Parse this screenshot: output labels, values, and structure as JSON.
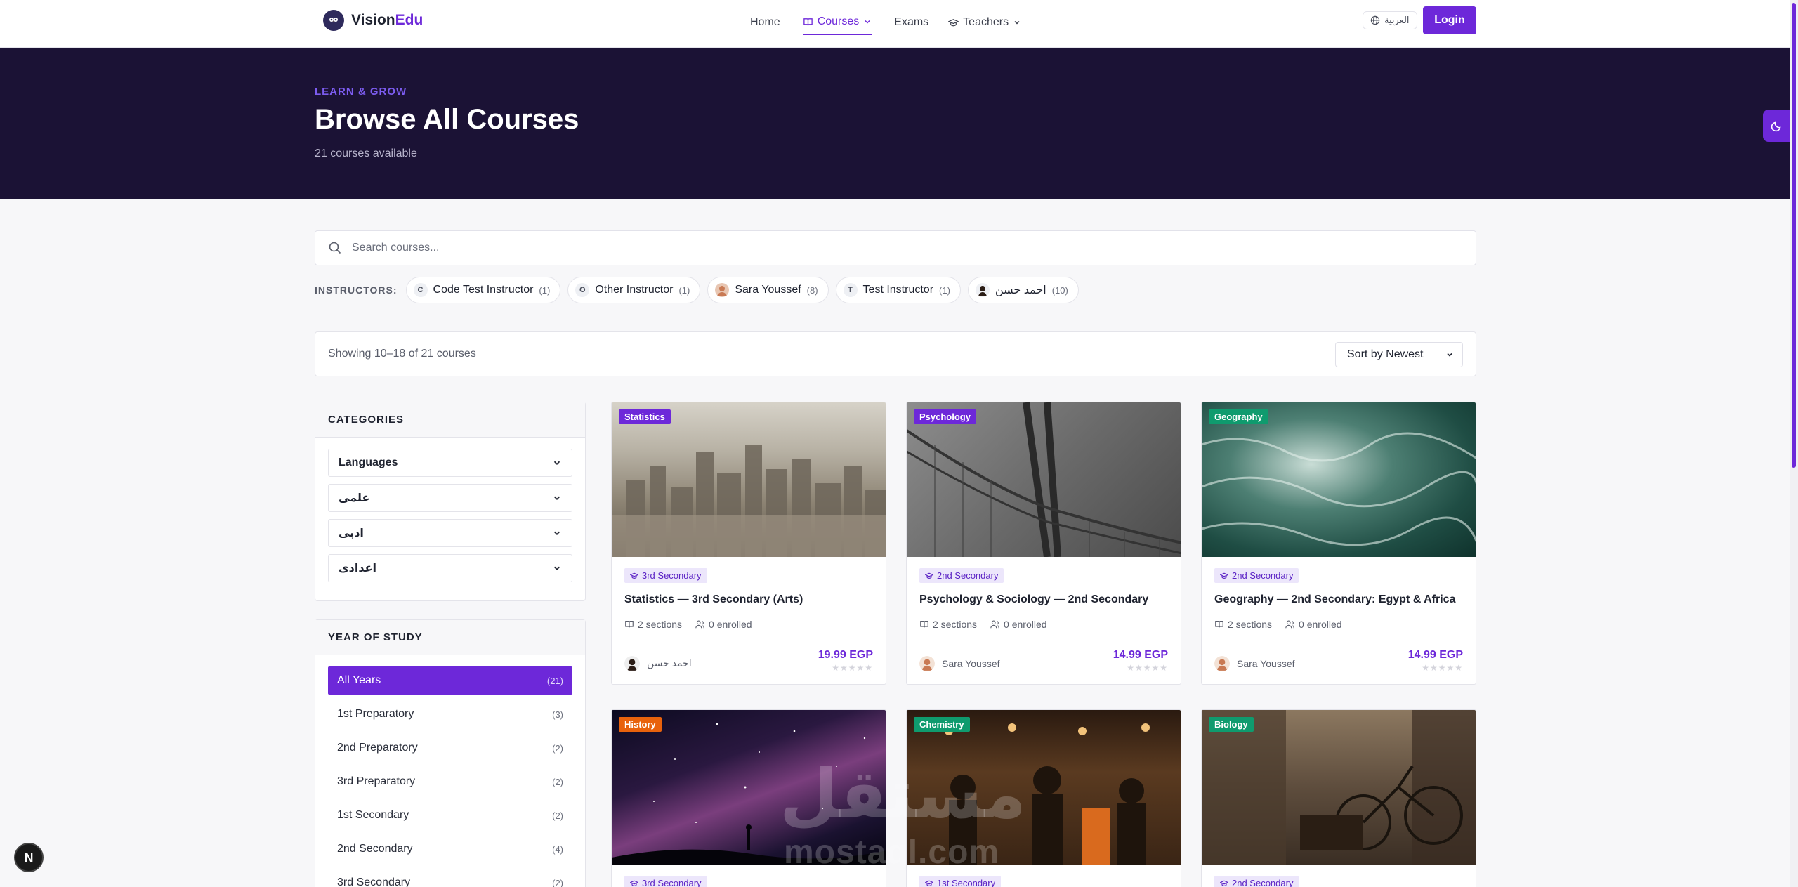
{
  "brand": {
    "name_main": "Vision",
    "name_accent": "Edu"
  },
  "nav": {
    "home": "Home",
    "courses": "Courses",
    "exams": "Exams",
    "teachers": "Teachers"
  },
  "header_actions": {
    "language": "العربية",
    "login": "Login"
  },
  "hero": {
    "eyebrow": "LEARN & GROW",
    "title": "Browse All Courses",
    "subtitle": "21 courses available"
  },
  "search": {
    "placeholder": "Search courses..."
  },
  "instructors": {
    "label": "INSTRUCTORS:",
    "items": [
      {
        "initial": "C",
        "name": "Code Test Instructor",
        "count": "(1)"
      },
      {
        "initial": "O",
        "name": "Other Instructor",
        "count": "(1)"
      },
      {
        "initial": "",
        "name": "Sara Youssef",
        "count": "(8)"
      },
      {
        "initial": "T",
        "name": "Test Instructor",
        "count": "(1)"
      },
      {
        "initial": "",
        "name": "احمد حسن",
        "count": "(10)"
      }
    ]
  },
  "toolbar": {
    "showing": "Showing 10–18 of 21 courses",
    "sort": "Sort by Newest"
  },
  "categories": {
    "title": "CATEGORIES",
    "items": [
      "Languages",
      "علمى",
      "ادبى",
      "اعدادى"
    ]
  },
  "years": {
    "title": "YEAR OF STUDY",
    "items": [
      {
        "label": "All Years",
        "count": "(21)"
      },
      {
        "label": "1st Preparatory",
        "count": "(3)"
      },
      {
        "label": "2nd Preparatory",
        "count": "(2)"
      },
      {
        "label": "3rd Preparatory",
        "count": "(2)"
      },
      {
        "label": "1st Secondary",
        "count": "(2)"
      },
      {
        "label": "2nd Secondary",
        "count": "(4)"
      },
      {
        "label": "3rd Secondary",
        "count": "(2)"
      }
    ]
  },
  "courses": [
    {
      "tag": "Statistics",
      "tag_color": "#6d28d9",
      "year": "3rd Secondary",
      "title": "Statistics — 3rd Secondary (Arts)",
      "sections": "2 sections",
      "enrolled": "0 enrolled",
      "author": "احمد حسن",
      "price": "19.99 EGP"
    },
    {
      "tag": "Psychology",
      "tag_color": "#6d28d9",
      "year": "2nd Secondary",
      "title": "Psychology & Sociology — 2nd Secondary",
      "sections": "2 sections",
      "enrolled": "0 enrolled",
      "author": "Sara Youssef",
      "price": "14.99 EGP"
    },
    {
      "tag": "Geography",
      "tag_color": "#0f9b6e",
      "year": "2nd Secondary",
      "title": "Geography — 2nd Secondary: Egypt & Africa",
      "sections": "2 sections",
      "enrolled": "0 enrolled",
      "author": "Sara Youssef",
      "price": "14.99 EGP"
    },
    {
      "tag": "History",
      "tag_color": "#e8620c",
      "year": "3rd Secondary"
    },
    {
      "tag": "Chemistry",
      "tag_color": "#0f9b6e",
      "year": "1st Secondary"
    },
    {
      "tag": "Biology",
      "tag_color": "#0f9b6e",
      "year": "2nd Secondary"
    }
  ],
  "stars": "★★★★★",
  "watermark": {
    "text": "مستقل",
    "url": "mostaql.com"
  },
  "dev_badge": "N"
}
